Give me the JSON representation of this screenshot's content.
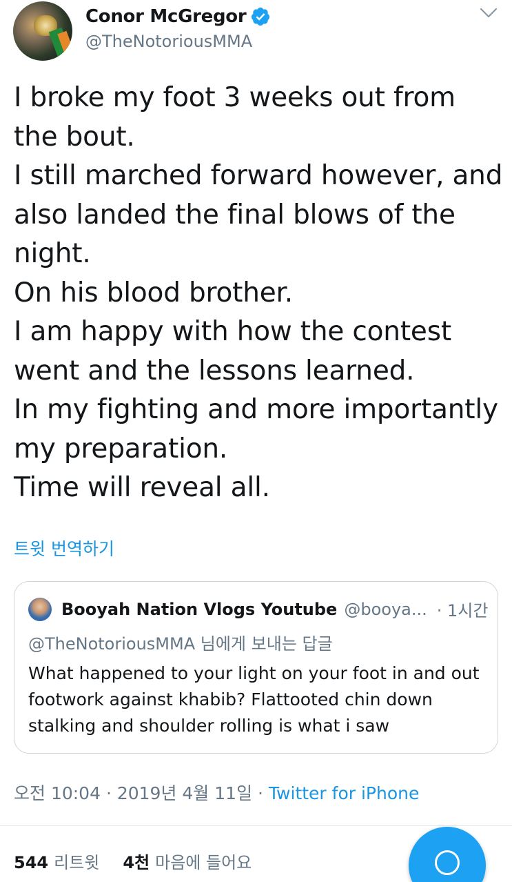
{
  "author": {
    "display_name": "Conor McGregor",
    "handle": "@TheNotoriousMMA",
    "verified": true,
    "avatar_icon": "profile-photo"
  },
  "tweet": {
    "lines": [
      "I broke my foot 3 weeks out from",
      "the bout.",
      "I still marched forward however, and",
      "also landed the final blows of the",
      "night.",
      "On his blood brother.",
      "I am happy with how the contest",
      "went and the lessons learned.",
      "In my fighting and more importantly",
      "my preparation.",
      "Time will reveal all."
    ],
    "translate_label": "트윗 번역하기"
  },
  "quoted_tweet": {
    "display_name": "Booyah Nation Vlogs Youtube",
    "handle": "@booya...",
    "time": "· 1시간",
    "reply_context": "@TheNotoriousMMA 님에게 보내는 답글",
    "lines": [
      "What happened to your light on your foot in and out",
      "footwork against khabib? Flattooted chin down",
      "stalking and shoulder rolling is what i saw"
    ]
  },
  "meta": {
    "timestamp": "오전 10:04 · 2019년 4월 11일 · ",
    "source": "Twitter for iPhone"
  },
  "stats": {
    "retweets_count": "544",
    "retweets_label": "리트윗",
    "likes_count": "4천",
    "likes_label": "마음에 들어요"
  },
  "colors": {
    "accent": "#1da1f2",
    "link": "#1b95e0",
    "secondary_text": "#657786",
    "border": "#ccd6dd"
  },
  "icons": {
    "verified": "verified-badge-icon",
    "caret": "chevron-down-icon",
    "compose": "compose-icon"
  }
}
